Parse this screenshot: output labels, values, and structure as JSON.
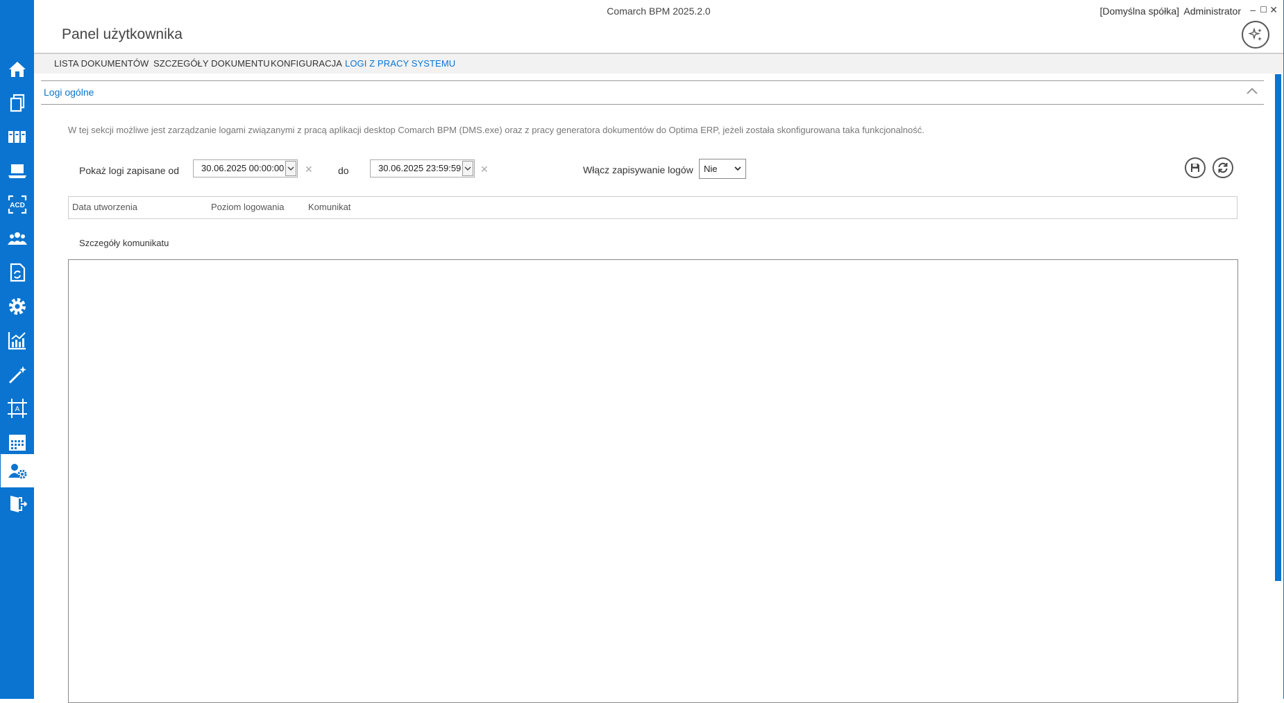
{
  "window": {
    "title": "Comarch BPM 2025.2.0",
    "company": "[Domyślna spółka]",
    "user": "Administrator",
    "controls": [
      "–",
      "☐",
      "✕"
    ]
  },
  "panel": {
    "title": "Panel użytkownika"
  },
  "sidebar": {
    "items": [
      {
        "icon": "home-icon"
      },
      {
        "icon": "documents-icon"
      },
      {
        "icon": "binders-icon"
      },
      {
        "icon": "laptop-icon"
      },
      {
        "icon": "ocr-acd-icon",
        "text": "ACD"
      },
      {
        "icon": "users-group-icon"
      },
      {
        "icon": "document-sync-icon"
      },
      {
        "icon": "gear-icon"
      },
      {
        "icon": "analytics-chart-icon"
      },
      {
        "icon": "magic-wand-icon"
      },
      {
        "icon": "designer-frame-icon",
        "text": "A"
      },
      {
        "icon": "calendar-icon"
      },
      {
        "icon": "user-settings-icon",
        "active": true
      },
      {
        "icon": "exit-door-icon"
      }
    ],
    "accent": "#0a74d0"
  },
  "tabs": [
    {
      "label": "LISTA DOKUMENTÓW"
    },
    {
      "label": "SZCZEGÓŁY DOKUMENTU"
    },
    {
      "label": "KONFIGURACJA"
    },
    {
      "label": "LOGI Z PRACY SYSTEMU",
      "active": true
    }
  ],
  "section": {
    "title": "Logi ogólne",
    "description": "W tej sekcji możliwe jest zarządzanie logami związanymi z pracą aplikacji desktop  Comarch BPM (DMS.exe) oraz z pracy generatora dokumentów do Optima ERP, jeżeli została skonfigurowana taka funkcjonalność."
  },
  "filters": {
    "from_label": "Pokaż logi zapisane od",
    "from_value": "30.06.2025 00:00:00",
    "to_label": "do",
    "to_value": "30.06.2025 23:59:59",
    "logging_label": "Włącz zapisywanie logów",
    "logging_value": "Nie"
  },
  "grid": {
    "columns": [
      "Data utworzenia",
      "Poziom logowania",
      "Komunikat"
    ]
  },
  "details": {
    "label": "Szczegóły komunikatu"
  }
}
